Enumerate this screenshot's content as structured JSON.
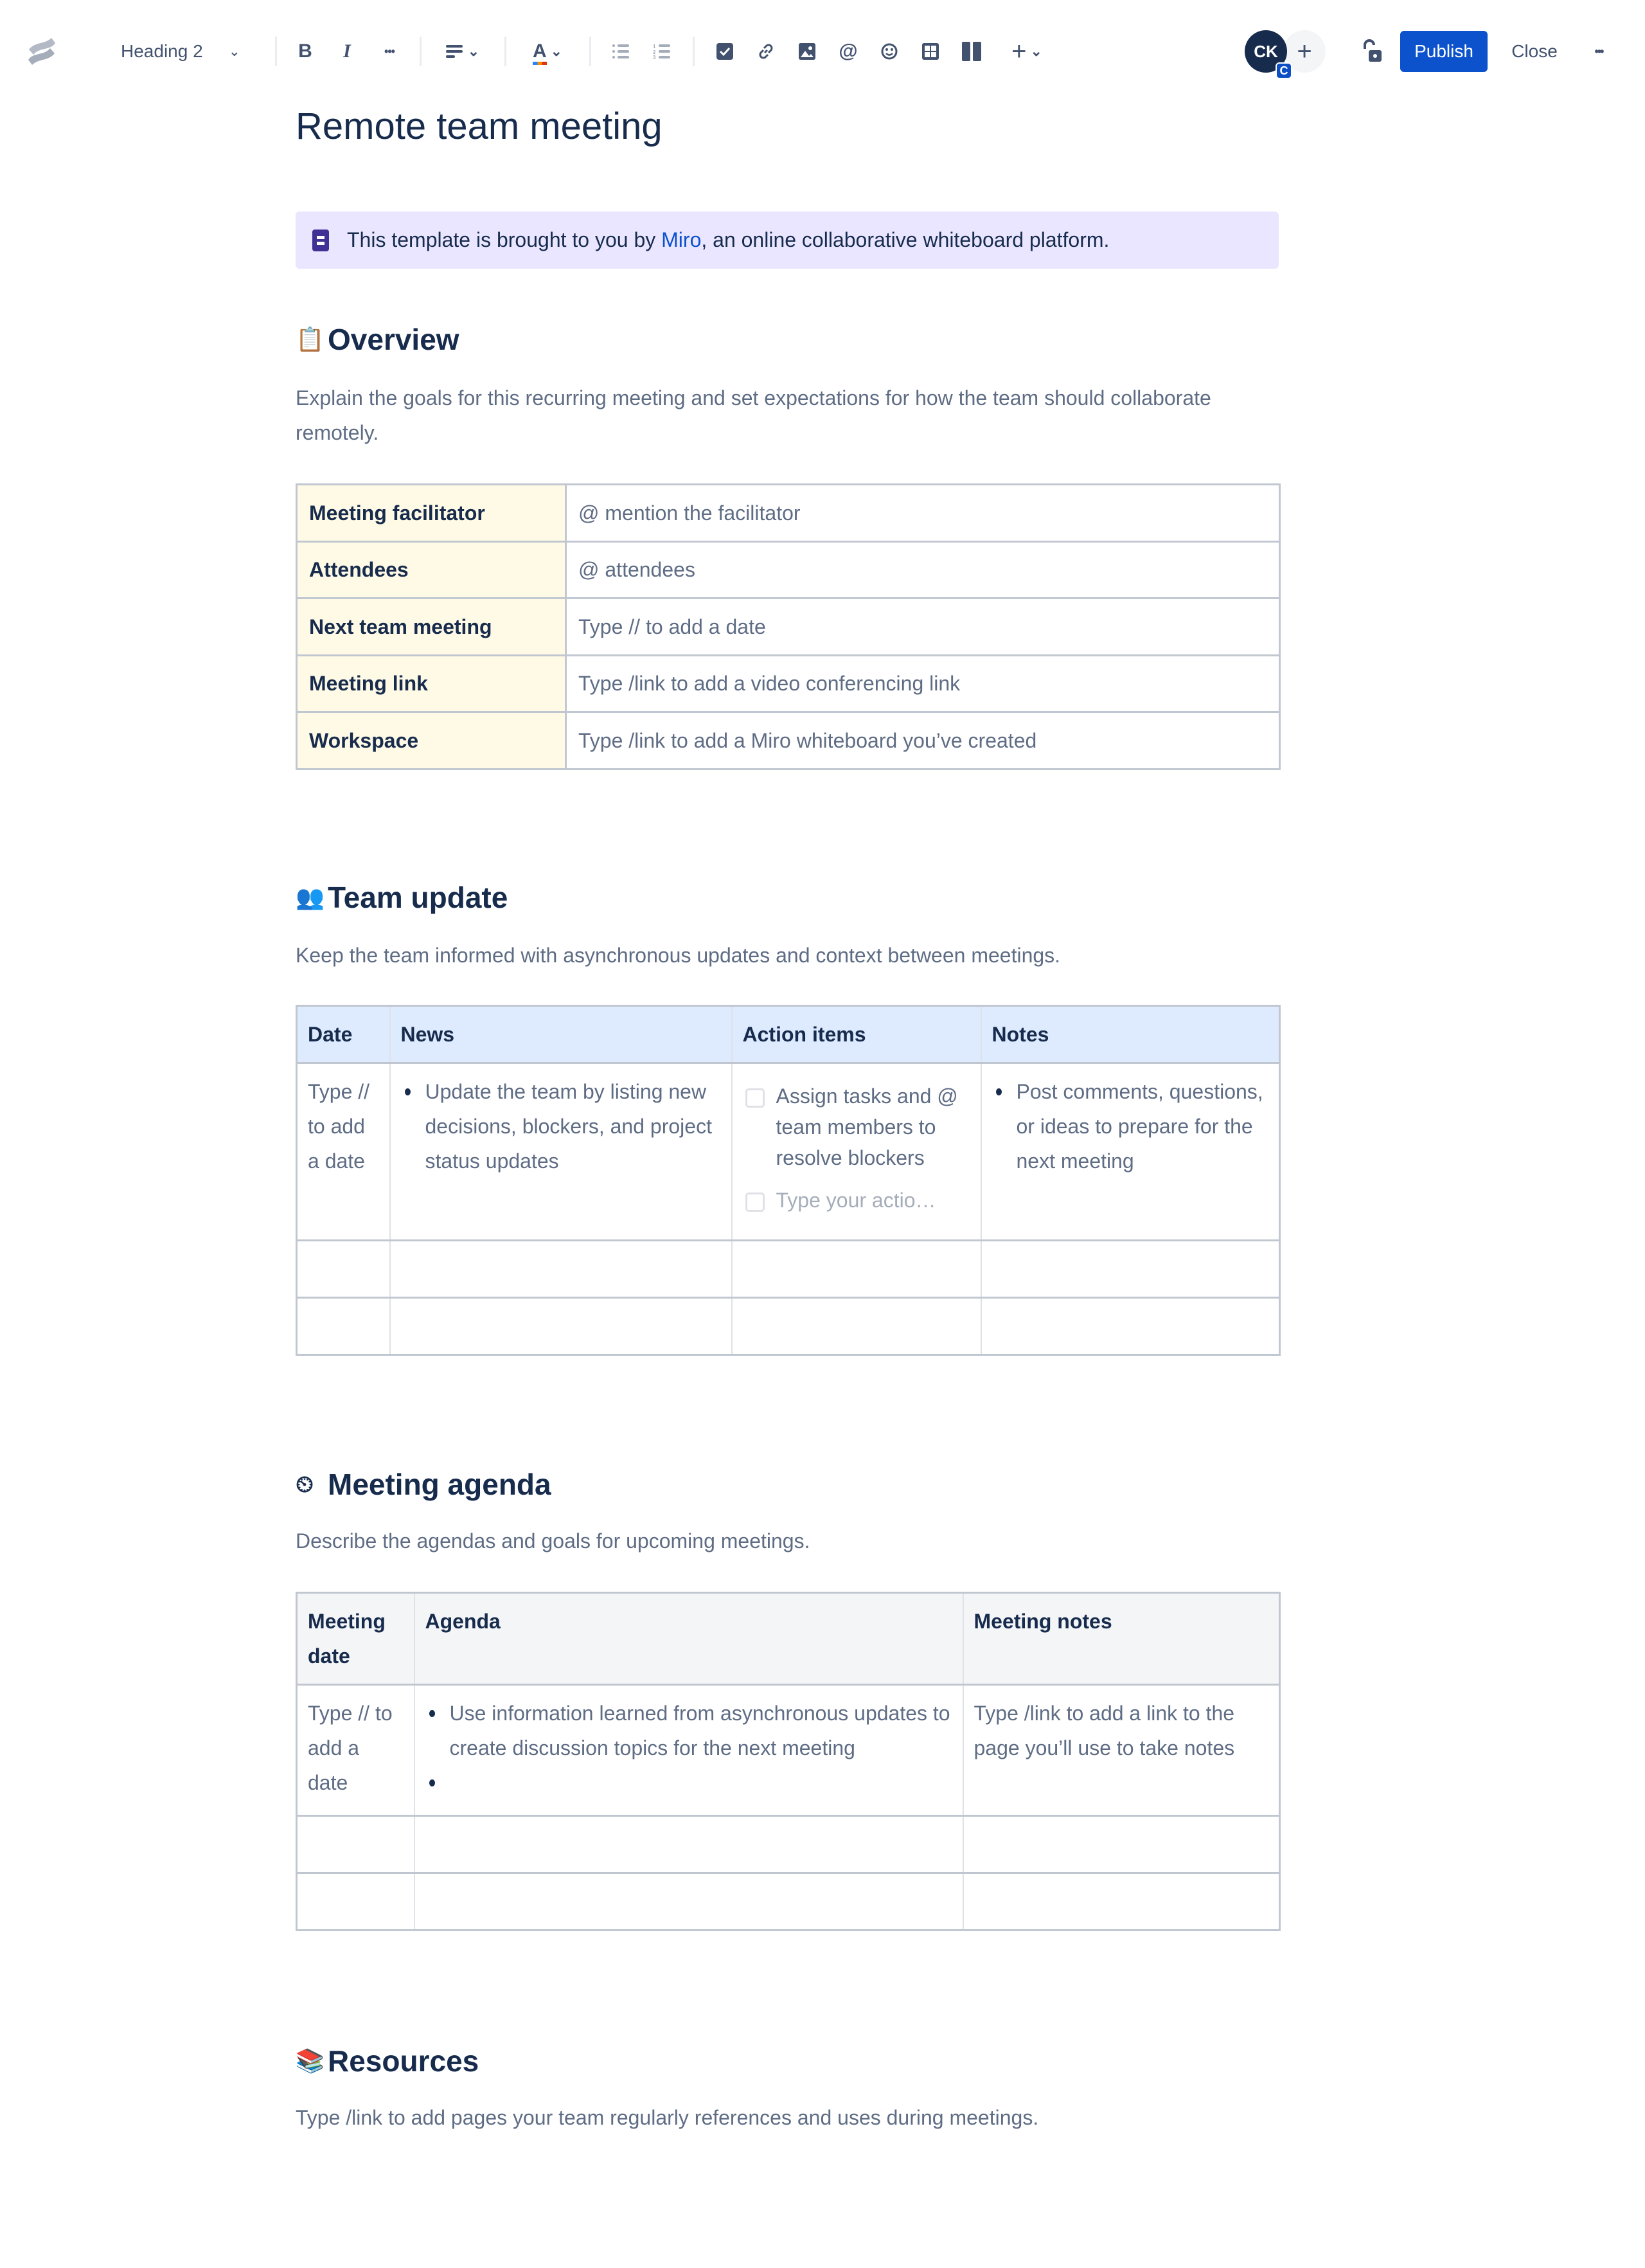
{
  "toolbar": {
    "app_logo": "confluence-logo",
    "text_style": "Heading 2",
    "buttons": {
      "bold": "B",
      "italic": "I",
      "more_formatting": "•••",
      "align": "align-left-icon",
      "text_color": "A",
      "bullet_list": "bullet-list-icon",
      "numbered_list": "numbered-list-icon",
      "action_item": "checkbox-icon",
      "link": "link-icon",
      "image": "image-icon",
      "mention": "@",
      "emoji": "emoji-icon",
      "table": "table-icon",
      "layouts": "layout-icon",
      "insert": "+"
    },
    "avatar_initials": "CK",
    "avatar_badge": "C",
    "invite_label": "+",
    "publish_label": "Publish",
    "close_label": "Close",
    "more_label": "•••"
  },
  "page": {
    "title": "Remote team meeting",
    "info_panel": {
      "text_before": "This template is brought to you by ",
      "link_text": "Miro",
      "text_after": ", an online collaborative whiteboard platform."
    },
    "overview": {
      "emoji": "📋",
      "heading": "Overview",
      "description": "Explain the goals for this recurring meeting and set expectations for how the team should collaborate remotely.",
      "rows": [
        {
          "label": "Meeting facilitator",
          "value": "@ mention the facilitator"
        },
        {
          "label": "Attendees",
          "value": "@ attendees"
        },
        {
          "label": "Next team meeting",
          "value": "Type // to add a date"
        },
        {
          "label": "Meeting link",
          "value": "Type /link to add a video conferencing link"
        },
        {
          "label": "Workspace",
          "value": "Type /link to add a Miro whiteboard you’ve created"
        }
      ]
    },
    "team_update": {
      "emoji": "👥",
      "heading": "Team update",
      "description": "Keep the team informed with asynchronous updates and context between meetings.",
      "columns": [
        "Date",
        "News",
        "Action items",
        "Notes"
      ],
      "row1": {
        "date": "Type // to add a date",
        "news": "Update the team by listing new decisions, blockers, and project status updates",
        "action_item": "Assign tasks and @ team members to resolve blockers",
        "action_placeholder": "Type your actio…",
        "notes": "Post comments, questions, or ideas to prepare for the next meeting"
      }
    },
    "meeting_agenda": {
      "emoji": "⏲",
      "heading": "Meeting agenda",
      "description": "Describe the agendas and goals for upcoming meetings.",
      "columns": [
        "Meeting date",
        "Agenda",
        "Meeting notes"
      ],
      "row1": {
        "date": "Type // to add a date",
        "agenda": "Use information learned from asynchronous updates to create discussion topics for the next meeting",
        "agenda_empty": "",
        "notes": "Type /link to add a link to the page you’ll use to take notes"
      }
    },
    "resources": {
      "emoji": "📚",
      "heading": "Resources",
      "description": "Type /link to add pages your team regularly references and uses during meetings."
    }
  }
}
